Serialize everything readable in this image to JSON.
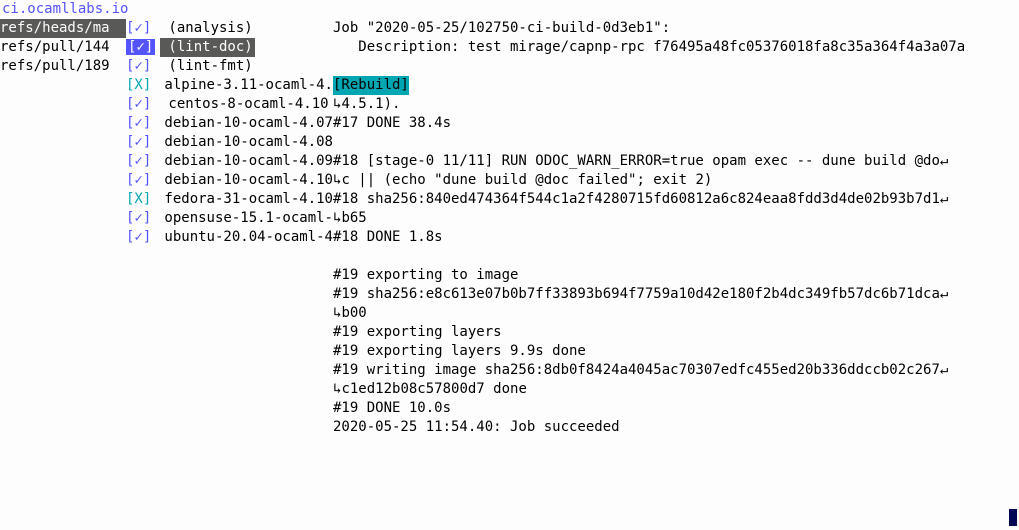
{
  "header": "ci.ocamllabs.io",
  "refs": [
    {
      "label": "refs/heads/ma",
      "selected": true
    },
    {
      "label": "refs/pull/144",
      "selected": false
    },
    {
      "label": "refs/pull/189",
      "selected": false
    }
  ],
  "jobs": [
    {
      "status": "[✓]",
      "status_kind": "ok",
      "name": "(analysis)",
      "selected": false
    },
    {
      "status": "[✓]",
      "status_kind": "ok",
      "name": "(lint-doc)",
      "selected": true
    },
    {
      "status": "[✓]",
      "status_kind": "ok",
      "name": "(lint-fmt)",
      "selected": false
    },
    {
      "status": "[X]",
      "status_kind": "fail",
      "name": "alpine-3.11-ocaml-4.",
      "selected": false
    },
    {
      "status": "[✓]",
      "status_kind": "ok",
      "name": "centos-8-ocaml-4.10",
      "selected": false
    },
    {
      "status": "[✓]",
      "status_kind": "ok",
      "name": "debian-10-ocaml-4.07",
      "selected": false
    },
    {
      "status": "[✓]",
      "status_kind": "ok",
      "name": "debian-10-ocaml-4.08",
      "selected": false
    },
    {
      "status": "[✓]",
      "status_kind": "ok",
      "name": "debian-10-ocaml-4.09",
      "selected": false
    },
    {
      "status": "[✓]",
      "status_kind": "ok",
      "name": "debian-10-ocaml-4.10",
      "selected": false
    },
    {
      "status": "[X]",
      "status_kind": "fail",
      "name": "fedora-31-ocaml-4.10",
      "selected": false
    },
    {
      "status": "[✓]",
      "status_kind": "ok",
      "name": "opensuse-15.1-ocaml-",
      "selected": false
    },
    {
      "status": "[✓]",
      "status_kind": "ok",
      "name": "ubuntu-20.04-ocaml-4",
      "selected": false
    }
  ],
  "log": [
    {
      "type": "text",
      "value": "Job \"2020-05-25/102750-ci-build-0d3eb1\":"
    },
    {
      "type": "text",
      "value": "   Description: test mirage/capnp-rpc f76495a48fc05376018fa8c35a364f4a3a07a"
    },
    {
      "type": "blank"
    },
    {
      "type": "rebuild",
      "value": "[Rebuild]"
    },
    {
      "type": "cont",
      "value": "4.5.1)."
    },
    {
      "type": "text",
      "value": "#17 DONE 38.4s"
    },
    {
      "type": "blank"
    },
    {
      "type": "wrap",
      "value": "#18 [stage-0 11/11] RUN ODOC_WARN_ERROR=true opam exec -- dune build @do"
    },
    {
      "type": "cont",
      "value": "c || (echo \"dune build @doc failed\"; exit 2)"
    },
    {
      "type": "wrap",
      "value": "#18 sha256:840ed474364f544c1a2f4280715fd60812a6c824eaa8fdd3d4de02b93b7d1"
    },
    {
      "type": "cont",
      "value": "b65"
    },
    {
      "type": "text",
      "value": "#18 DONE 1.8s"
    },
    {
      "type": "blank"
    },
    {
      "type": "text",
      "value": "#19 exporting to image"
    },
    {
      "type": "wrap",
      "value": "#19 sha256:e8c613e07b0b7ff33893b694f7759a10d42e180f2b4dc349fb57dc6b71dca"
    },
    {
      "type": "cont",
      "value": "b00"
    },
    {
      "type": "text",
      "value": "#19 exporting layers"
    },
    {
      "type": "text",
      "value": "#19 exporting layers 9.9s done"
    },
    {
      "type": "wrap",
      "value": "#19 writing image sha256:8db0f8424a4045ac70307edfc455ed20b336ddccb02c267"
    },
    {
      "type": "cont",
      "value": "c1ed12b08c57800d7 done"
    },
    {
      "type": "text",
      "value": "#19 DONE 10.0s"
    },
    {
      "type": "text",
      "value": "2020-05-25 11:54.40: Job succeeded"
    }
  ]
}
